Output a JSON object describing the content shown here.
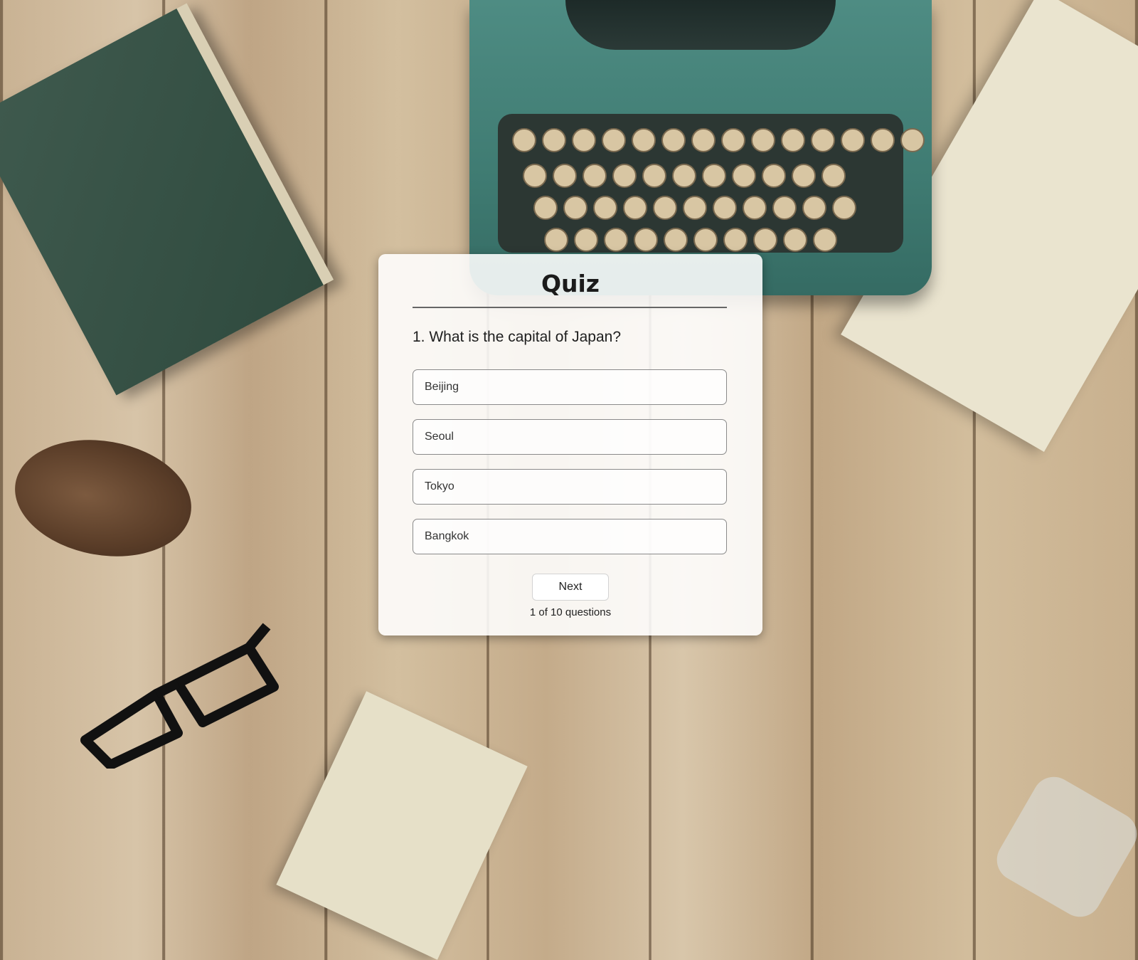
{
  "quiz": {
    "title": "Quiz",
    "question": "1. What is the capital of Japan?",
    "options": [
      "Beijing",
      "Seoul",
      "Tokyo",
      "Bangkok"
    ],
    "next_label": "Next",
    "progress": "1 of 10 questions"
  },
  "background": {
    "scene": "wooden desk with typewriter, book, pinecone, glasses and notepads"
  }
}
